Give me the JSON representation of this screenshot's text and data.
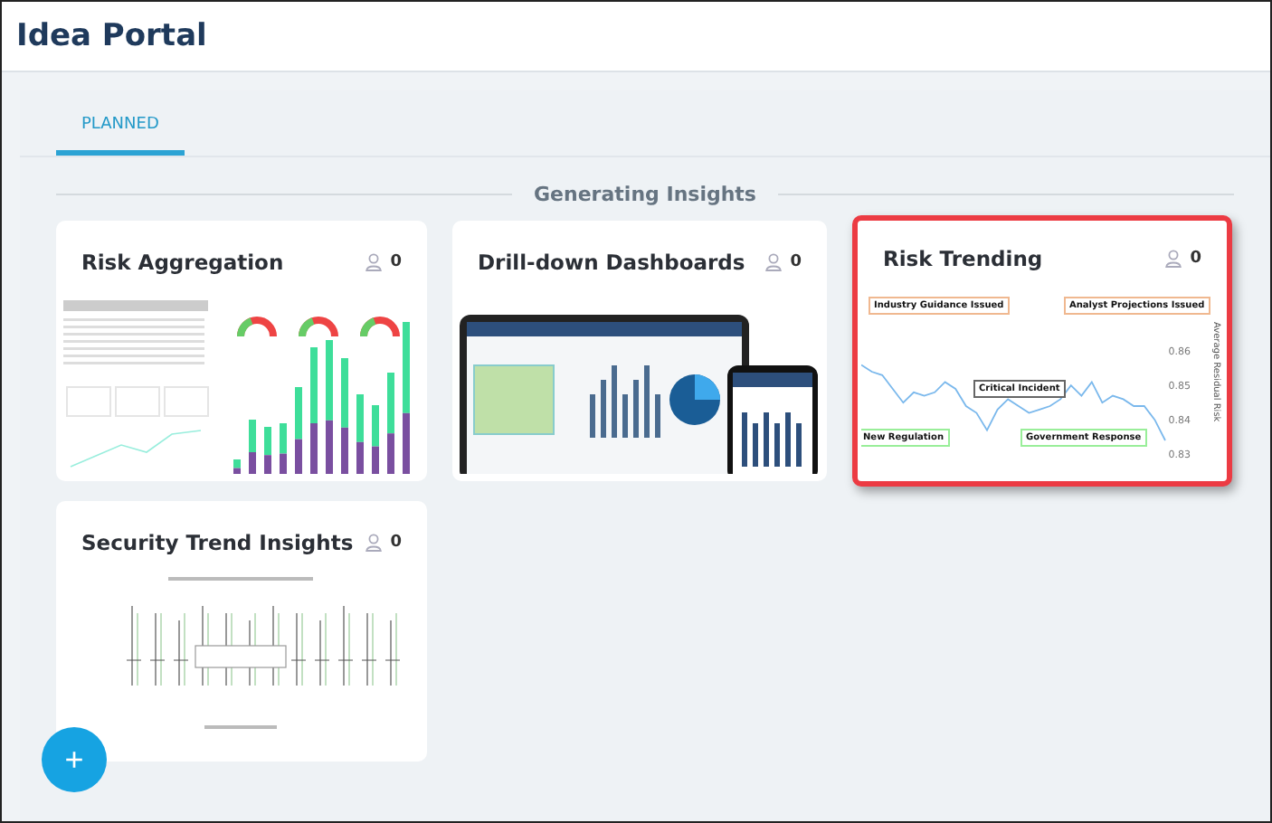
{
  "header": {
    "title": "Idea Portal"
  },
  "tabs": [
    {
      "label": "PLANNED",
      "selected": true
    }
  ],
  "section": {
    "title": "Generating Insights"
  },
  "cards": [
    {
      "title": "Risk Aggregation",
      "votes": "0",
      "highlighted": false,
      "preview": {
        "kind": "dashboard"
      }
    },
    {
      "title": "Drill-down Dashboards",
      "votes": "0",
      "highlighted": false,
      "preview": {
        "kind": "devices"
      }
    },
    {
      "title": "Risk Trending",
      "votes": "0",
      "highlighted": true,
      "preview": {
        "kind": "trend",
        "top_labels": [
          "Industry Guidance Issued",
          "Analyst Projections Issued"
        ],
        "middle_label": "Critical Incident",
        "bottom_labels": [
          "New Regulation",
          "Government Response"
        ],
        "chart_data": {
          "type": "line",
          "ylabel": "Average Residual Risk",
          "ylim": [
            0.83,
            0.86
          ],
          "yticks": [
            0.86,
            0.85,
            0.84,
            0.83
          ],
          "series": [
            {
              "color": "#7ab8ec",
              "values": [
                0.857,
                0.855,
                0.854,
                0.85,
                0.846,
                0.849,
                0.848,
                0.849,
                0.852,
                0.85,
                0.845,
                0.843,
                0.838,
                0.844,
                0.847,
                0.845,
                0.843,
                0.844,
                0.845,
                0.847,
                0.851,
                0.848,
                0.852,
                0.846,
                0.848,
                0.847,
                0.845,
                0.845,
                0.841,
                0.835
              ]
            }
          ]
        }
      }
    },
    {
      "title": "Security Trend Insights",
      "votes": "0",
      "highlighted": false,
      "preview": {
        "kind": "boxplot"
      }
    }
  ],
  "fab": {
    "label": "+"
  }
}
